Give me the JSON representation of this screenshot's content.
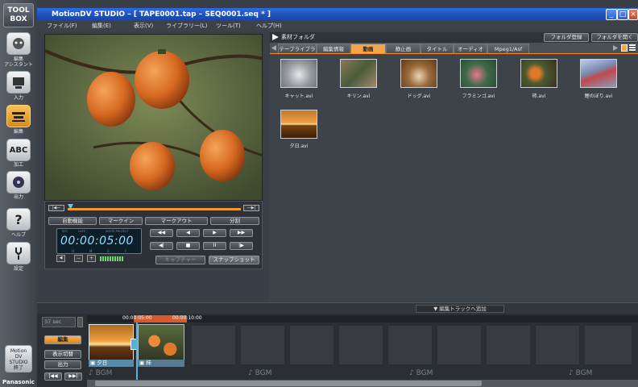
{
  "rail": {
    "logo_line1": "TOOL",
    "logo_line2": "BOX",
    "items": [
      {
        "label": "編集\nアシスタント",
        "icon": "assistant-icon"
      },
      {
        "label": "入力",
        "icon": "capture-input-icon"
      },
      {
        "label": "編集",
        "icon": "edit-icon"
      },
      {
        "label": "加工",
        "icon": "abc-text-icon",
        "glyph": "ABC"
      },
      {
        "label": "出力",
        "icon": "disc-output-icon"
      },
      {
        "label": "ヘルプ",
        "icon": "help-icon",
        "glyph": "?"
      },
      {
        "label": "設定",
        "icon": "settings-icon"
      }
    ],
    "exit_lines": [
      "Motion",
      "DV",
      "STUDIO",
      "終了"
    ],
    "brand": "Panasonic"
  },
  "window": {
    "title": "MotionDV STUDIO – [ TAPE0001.tap – SEQ0001.seq * ]",
    "accent": "#2d6be3"
  },
  "menu": [
    "ファイル(F)",
    "編集(E)",
    "表示(V)",
    "ライブラリー(L)",
    "ツール(T)",
    "ヘルプ(H)"
  ],
  "player": {
    "buttons_row1": [
      "自動機能",
      "マークイン",
      "マークアウト",
      "分割"
    ],
    "timecode": "00:00:05:00",
    "tc_top_labels": [
      "REC",
      "DATE",
      "WHITE PROTECT"
    ],
    "tc_bottom_labels": [
      "H",
      "M",
      "S",
      "F"
    ],
    "capture_label": "キャプチャー",
    "snapshot_label": "スナップショット",
    "mark_start": "|◀—",
    "mark_end": "—▶|"
  },
  "library": {
    "folder_label": "素材フォルダ",
    "register_folder": "フォルダ登録",
    "open_folder": "フォルダを開く",
    "tabs": [
      "テープライブラリ",
      "編集情報",
      "動画",
      "静止画",
      "タイトル",
      "オーディオ",
      "Mpeg1/Asf"
    ],
    "active_tab": 2,
    "items": [
      {
        "name": "キャット.avi",
        "color": "#b5b8bd"
      },
      {
        "name": "キリン.avi",
        "color": "#7a6a4a"
      },
      {
        "name": "ドッグ.avi",
        "color": "#8a6a3a"
      },
      {
        "name": "フラミンゴ.avi",
        "color": "#3d6a4a"
      },
      {
        "name": "柿.avi",
        "color": "#5a4a30"
      },
      {
        "name": "鯉のぼり.avi",
        "color": "#7a8ab0"
      },
      {
        "name": "夕日.avi",
        "color": "#c06a20"
      }
    ]
  },
  "timeline": {
    "add_to_track": "▼ 編集トラックへ追加",
    "duration": "37 sec",
    "ticks": [
      "00:00:05:00",
      "00:00:10:00"
    ],
    "side_buttons": [
      "編集",
      "表示切替",
      "出力"
    ],
    "clips": [
      {
        "label": "夕日"
      },
      {
        "label": "柿"
      }
    ],
    "bgm_label": "♪ BGM"
  }
}
